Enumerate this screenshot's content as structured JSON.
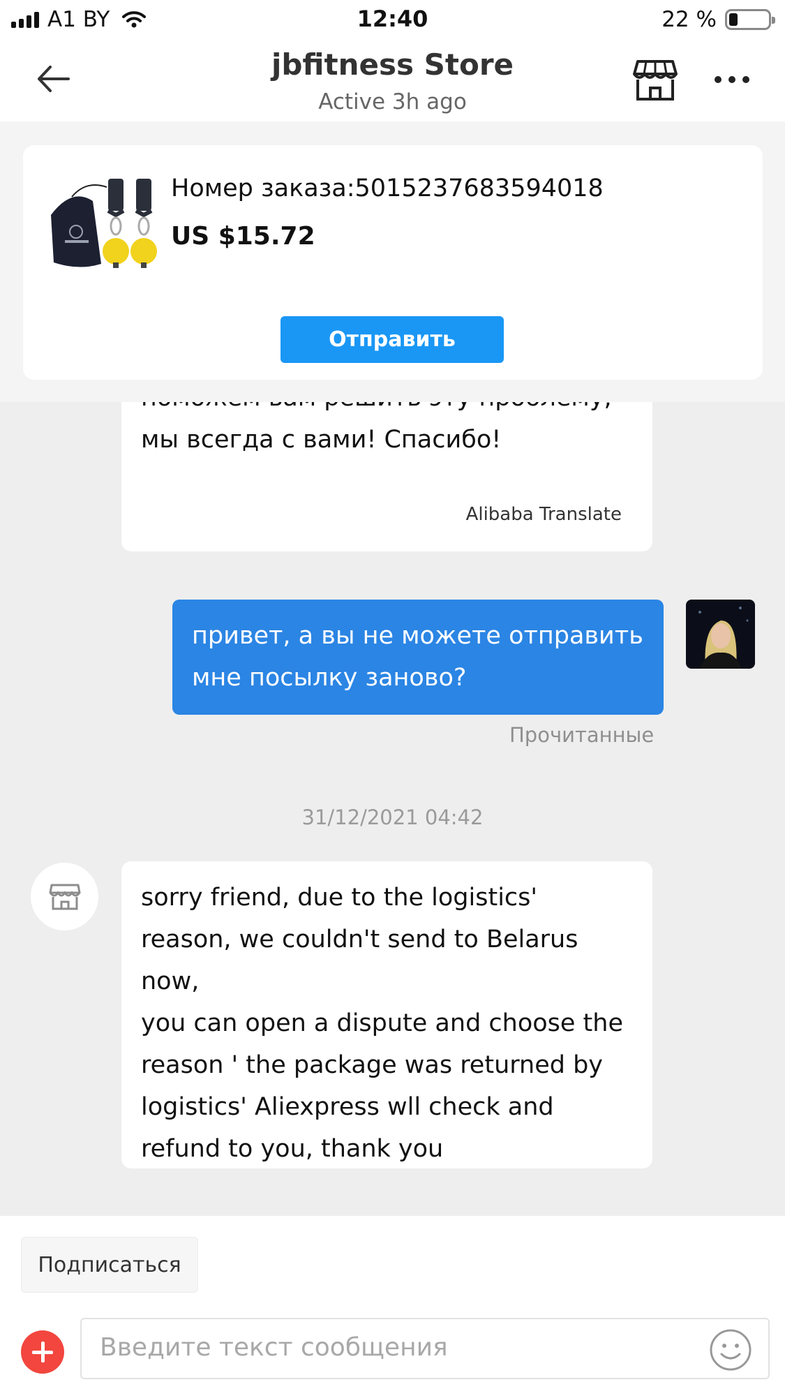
{
  "status_bar": {
    "carrier": "A1 BY",
    "time": "12:40",
    "battery": "22 %"
  },
  "header": {
    "title": "jbfitness Store",
    "subtitle": "Active 3h ago"
  },
  "order": {
    "number": "Номер заказа:5015237683594018",
    "price": "US $15.72",
    "send_button": "Отправить"
  },
  "messages": [
    {
      "from": "store",
      "text": "поможем вам решить эту проблему,\nмы всегда с вами! Спасибо!",
      "translate_label": "Alibaba Translate"
    },
    {
      "from": "me",
      "text": "привет, а вы не можете отправить\nмне посылку заново?",
      "status": "Прочитанные"
    },
    {
      "date": "31/12/2021 04:42"
    },
    {
      "from": "store",
      "text": "sorry friend, due to the logistics'\nreason, we couldn't send to Belarus\nnow,\nyou can open a dispute and choose the\nreason ' the package was returned by\nlogistics' Aliexpress wll check and\nrefund to you, thank you"
    }
  ],
  "composer": {
    "subscribe_button": "Подписаться",
    "input_placeholder": "Введите текст сообщения"
  },
  "colors": {
    "accent_blue": "#1a97f5",
    "my_bubble": "#2b85e4",
    "plus_red": "#f2463e"
  },
  "icons": [
    "back-arrow-icon",
    "store-icon",
    "more-icon",
    "store-avatar-icon",
    "plus-icon",
    "emoji-icon",
    "wifi-icon",
    "signal-icon",
    "battery-icon"
  ]
}
